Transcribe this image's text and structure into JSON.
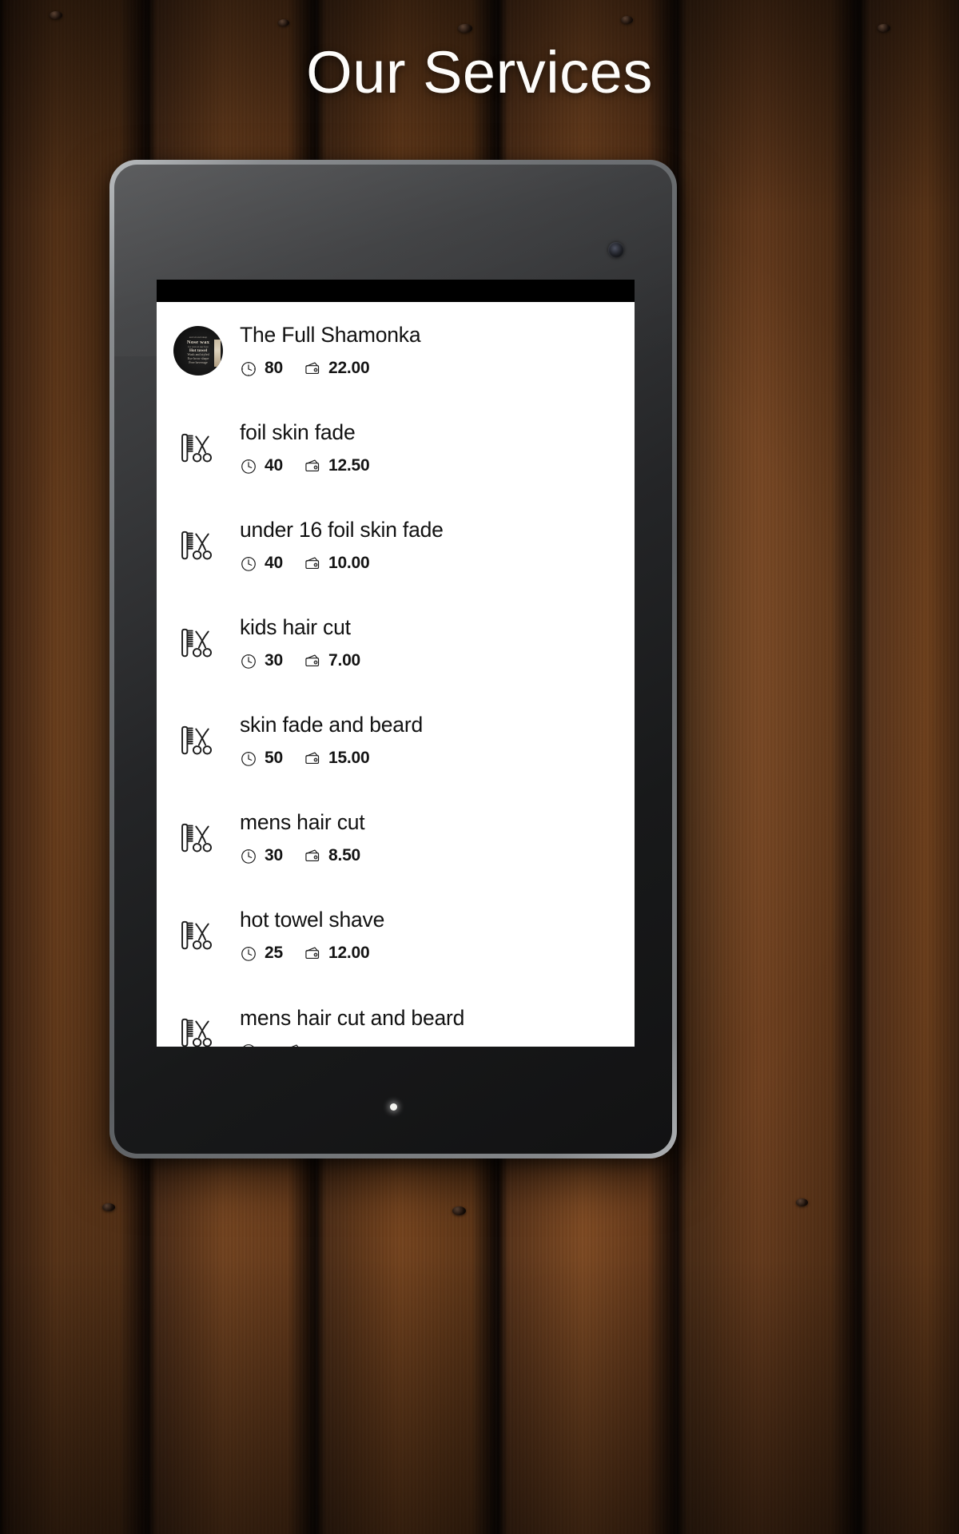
{
  "page": {
    "title": "Our Services",
    "background": "wood-planks",
    "title_color": "#fdfcfa"
  },
  "device": {
    "type": "tablet",
    "bezel_color": "#6e7174",
    "screen_background": "#ffffff",
    "status_bar_color": "#000000"
  },
  "app": {
    "list_name": "services-list",
    "divider_color": "#e3e3e3",
    "text_color": "#121212",
    "services": [
      {
        "name": "The Full Shamonka",
        "icon": "photo-thumbnail",
        "duration": "80",
        "price": "22.00",
        "thumbnail_lines": [
          "and sit and sleep",
          "Nose wax",
          "for wax at our face",
          "Hot towel",
          "Wash and styled",
          "Eye brow shape",
          "Free beverage"
        ]
      },
      {
        "name": "foil skin fade",
        "icon": "comb-scissors-icon",
        "duration": "40",
        "price": "12.50"
      },
      {
        "name": "under 16 foil skin fade",
        "icon": "comb-scissors-icon",
        "duration": "40",
        "price": "10.00"
      },
      {
        "name": "kids hair cut",
        "icon": "comb-scissors-icon",
        "duration": "30",
        "price": "7.00"
      },
      {
        "name": "skin fade and beard",
        "icon": "comb-scissors-icon",
        "duration": "50",
        "price": "15.00"
      },
      {
        "name": "mens hair cut",
        "icon": "comb-scissors-icon",
        "duration": "30",
        "price": "8.50"
      },
      {
        "name": "hot towel shave",
        "icon": "comb-scissors-icon",
        "duration": "25",
        "price": "12.00"
      },
      {
        "name": "mens hair cut and beard",
        "icon": "comb-scissors-icon",
        "duration": "",
        "price": ""
      }
    ]
  },
  "icons": {
    "duration": "clock-icon",
    "price": "wallet-icon",
    "service": "comb-scissors-icon",
    "camera": "camera-lens-icon",
    "led": "led-indicator-icon"
  }
}
